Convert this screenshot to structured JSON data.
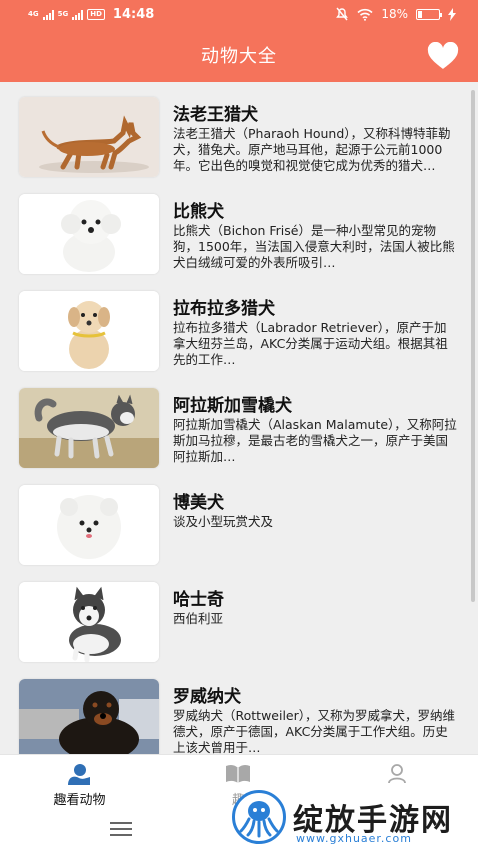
{
  "status_bar": {
    "net_1": "4G",
    "net_2": "5G",
    "hd_badge": "HD",
    "time": "14:48",
    "battery": "18%",
    "battery_level": 0.18
  },
  "header": {
    "title": "动物大全"
  },
  "animals": [
    {
      "name": "法老王猎犬",
      "desc": "法老王猎犬（Pharaoh Hound），又称科博特菲勒犬，猎兔犬。原产地马耳他，起源于公元前1000年。它出色的嗅觉和视觉使它成为优秀的猎犬…"
    },
    {
      "name": "比熊犬",
      "desc": "比熊犬（Bichon Frisé）是一种小型常见的宠物狗，1500年，当法国入侵意大利时，法国人被比熊犬白绒绒可爱的外表所吸引…"
    },
    {
      "name": "拉布拉多猎犬",
      "desc": "拉布拉多猎犬（Labrador Retriever），原产于加拿大纽芬兰岛，AKC分类属于运动犬组。根据其祖先的工作…"
    },
    {
      "name": "阿拉斯加雪橇犬",
      "desc": "阿拉斯加雪橇犬（Alaskan Malamute），又称阿拉斯加马拉穆，是最古老的雪橇犬之一，原产于美国阿拉斯加…"
    },
    {
      "name": "博美犬",
      "desc": "谈及小型玩赏犬及"
    },
    {
      "name": "哈士奇",
      "desc": "西伯利亚"
    },
    {
      "name": "罗威纳犬",
      "desc": "罗威纳犬（Rottweiler），又称为罗威拿犬，罗纳维德犬，原产于德国，AKC分类属于工作犬组。历史上该犬曾用于…"
    }
  ],
  "bottom_nav": {
    "tabs": [
      {
        "label": "趣看动物",
        "icon": "animal-person-icon",
        "active": true
      },
      {
        "label": "趣",
        "icon": "book-icon",
        "active": false
      },
      {
        "label": "",
        "icon": "user-icon",
        "active": false
      }
    ]
  },
  "watermark": {
    "text": "绽放手游网",
    "url": "www.gxhuaer.com"
  },
  "colors": {
    "accent": "#f5735b",
    "nav_active": "#2f6fb5",
    "watermark_blue": "#2a7fd6"
  }
}
